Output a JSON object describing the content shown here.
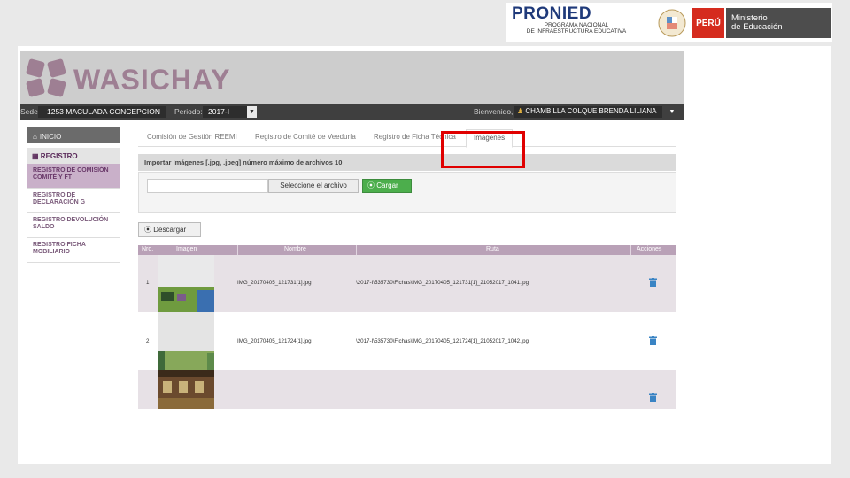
{
  "logos": {
    "pronied_title": "PRONIED",
    "pronied_sub_1": "PROGRAMA NACIONAL",
    "pronied_sub_2": "DE INFRAESTRUCTURA EDUCATIVA",
    "peru": "PERÚ",
    "minedu_1": "Ministerio",
    "minedu_2": "de Educación"
  },
  "brand": {
    "name": "WASICHAY"
  },
  "navbar": {
    "sede_label": "Sede:",
    "sede_value": "1253 MACULADA CONCEPCION",
    "periodo_label": "Periodo:",
    "periodo_value": "2017-I",
    "welcome_label": "Bienvenido,",
    "user_name": "CHAMBILLA COLQUE BRENDA LILIANA"
  },
  "sidebar": {
    "inicio": "INICIO",
    "registro": "REGISTRO",
    "items": [
      {
        "label_1": "REGISTRO DE COMISIÓN",
        "label_2": "COMITÉ Y FT"
      },
      {
        "label_1": "REGISTRO DE",
        "label_2": "DECLARACIÓN G"
      },
      {
        "label_1": "REGISTRO DEVOLUCIÓN",
        "label_2": "SALDO"
      },
      {
        "label_1": "REGISTRO FICHA",
        "label_2": "MOBILIARIO"
      }
    ]
  },
  "tabs": [
    "Comisión de Gestión REEMI",
    "Registro de Comité de Veeduría",
    "Registro de Ficha Técnica",
    "Imágenes"
  ],
  "import": {
    "heading": "Importar Imágenes [.jpg, .jpeg] número máximo de archivos 10",
    "select_label": "Seleccione el archivo",
    "upload_label": "Cargar"
  },
  "download_label": "Descargar",
  "table": {
    "headers": [
      "Nro.",
      "Imagen",
      "Nombre",
      "Ruta",
      "Acciones"
    ],
    "rows": [
      {
        "nro": "1",
        "nombre": "IMG_20170405_121731[1].jpg",
        "ruta": "\\2017-I\\535730\\Fichas\\IMG_20170405_121731[1]_21052017_1041.jpg"
      },
      {
        "nro": "2",
        "nombre": "IMG_20170405_121724[1].jpg",
        "ruta": "\\2017-I\\535730\\Fichas\\IMG_20170405_121724[1]_21052017_1042.jpg"
      },
      {
        "nro": "",
        "nombre": "",
        "ruta": ""
      }
    ]
  },
  "colors": {
    "accent": "#b9a1b7",
    "highlight": "#e00000",
    "upload": "#4cae4c",
    "trash": "#3a84c4"
  },
  "icons": [
    "home-icon",
    "registro-icon",
    "upload-icon",
    "download-icon",
    "user-icon",
    "trash-icon"
  ]
}
